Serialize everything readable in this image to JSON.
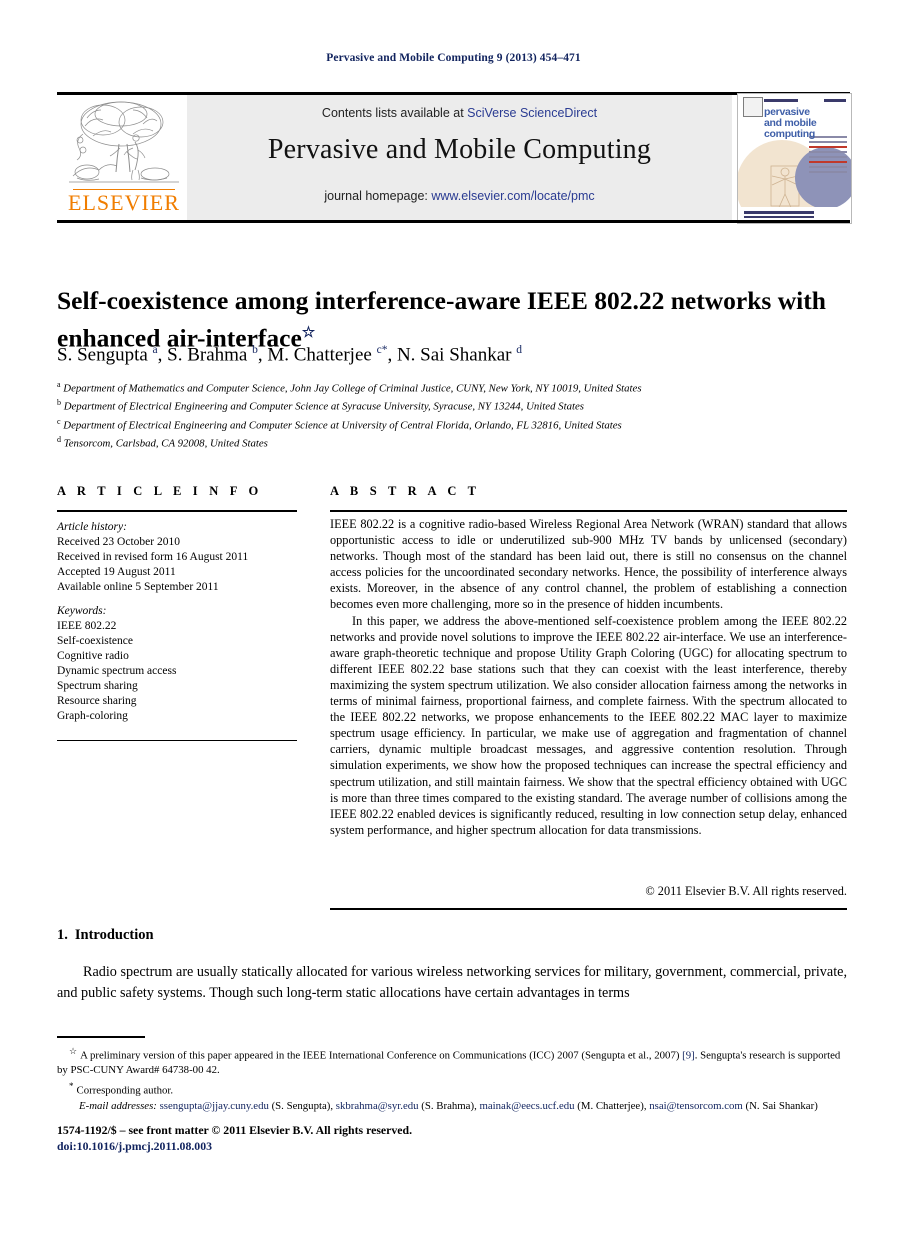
{
  "running_head": "Pervasive and Mobile Computing 9 (2013) 454–471",
  "masthead": {
    "contents_prefix": "Contents lists available at ",
    "contents_link": "SciVerse ScienceDirect",
    "journal_title": "Pervasive and Mobile Computing",
    "homepage_prefix": "journal homepage: ",
    "homepage_link": "www.elsevier.com/locate/pmc",
    "publisher_wordmark": "ELSEVIER"
  },
  "cover": {
    "line1": "pervasive",
    "line2": "and mobile",
    "line3": "computing"
  },
  "article": {
    "title": "Self-coexistence among interference-aware IEEE 802.22 networks with enhanced air-interface",
    "title_marker": "☆",
    "authors": "S. Sengupta <sup>a</sup>, S. Brahma <sup>b</sup>, M. Chatterjee <sup>c</sup><sup>*</sup>, N. Sai Shankar <sup>d</sup>",
    "affiliations": [
      {
        "marker": "a",
        "text": "Department of Mathematics and Computer Science, John Jay College of Criminal Justice, CUNY, New York, NY 10019, United States"
      },
      {
        "marker": "b",
        "text": "Department of Electrical Engineering and Computer Science at Syracuse University, Syracuse, NY 13244, United States"
      },
      {
        "marker": "c",
        "text": "Department of Electrical Engineering and Computer Science at University of Central Florida, Orlando, FL 32816, United States"
      },
      {
        "marker": "d",
        "text": "Tensorcom, Carlsbad, CA 92008, United States"
      }
    ]
  },
  "article_info": {
    "label": "A R T I C L E   I N F O",
    "history_heading": "Article history:",
    "history": [
      "Received 23 October 2010",
      "Received in revised form 16 August 2011",
      "Accepted 19 August 2011",
      "Available online 5 September 2011"
    ],
    "keywords_heading": "Keywords:",
    "keywords": [
      "IEEE 802.22",
      "Self-coexistence",
      "Cognitive radio",
      "Dynamic spectrum access",
      "Spectrum sharing",
      "Resource sharing",
      "Graph-coloring"
    ]
  },
  "abstract": {
    "label": "A B S T R A C T",
    "paragraph1": "IEEE 802.22 is a cognitive radio-based Wireless Regional Area Network (WRAN) standard that allows opportunistic access to idle or underutilized sub-900 MHz TV bands by unlicensed (secondary) networks. Though most of the standard has been laid out, there is still no consensus on the channel access policies for the uncoordinated secondary networks. Hence, the possibility of interference always exists. Moreover, in the absence of any control channel, the problem of establishing a connection becomes even more challenging, more so in the presence of hidden incumbents.",
    "paragraph2": "In this paper, we address the above-mentioned self-coexistence problem among the IEEE 802.22 networks and provide novel solutions to improve the IEEE 802.22 air-interface. We use an interference-aware graph-theoretic technique and propose Utility Graph Coloring (UGC) for allocating spectrum to different IEEE 802.22 base stations such that they can coexist with the least interference, thereby maximizing the system spectrum utilization. We also consider allocation fairness among the networks in terms of minimal fairness, proportional fairness, and complete fairness. With the spectrum allocated to the IEEE 802.22 networks, we propose enhancements to the IEEE 802.22 MAC layer to maximize spectrum usage efficiency. In particular, we make use of aggregation and fragmentation of channel carriers, dynamic multiple broadcast messages, and aggressive contention resolution. Through simulation experiments, we show how the proposed techniques can increase the spectral efficiency and spectrum utilization, and still maintain fairness. We show that the spectral efficiency obtained with UGC is more than three times compared to the existing standard. The average number of collisions among the IEEE 802.22 enabled devices is significantly reduced, resulting in low connection setup delay, enhanced system performance, and higher spectrum allocation for data transmissions.",
    "copyright": "© 2011 Elsevier B.V. All rights reserved."
  },
  "body": {
    "section_number": "1.",
    "section_title": "Introduction",
    "paragraph1": "Radio spectrum are usually statically allocated for various wireless networking services for military, government, commercial, private, and public safety systems. Though such long-term static allocations have certain advantages in terms"
  },
  "footnotes": {
    "star_marker": "☆",
    "star_text_a": "A preliminary version of this paper appeared in the IEEE International Conference on Communications (ICC) 2007 (Sengupta et al., 2007) ",
    "star_ref": "[9]",
    "star_text_b": ". Sengupta's research is supported by PSC-CUNY Award# 64738-00 42.",
    "asterisk_marker": "*",
    "corresponding": "Corresponding author.",
    "email_label": "E-mail addresses:",
    "emails": [
      {
        "address": "ssengupta@jjay.cuny.edu",
        "owner": "(S. Sengupta)"
      },
      {
        "address": "skbrahma@syr.edu",
        "owner": "(S. Brahma)"
      },
      {
        "address": "mainak@eecs.ucf.edu",
        "owner": "(M. Chatterjee)"
      },
      {
        "address": "nsai@tensorcom.com",
        "owner": "(N. Sai Shankar)"
      }
    ]
  },
  "imprint": {
    "issn_line": "1574-1192/$ – see front matter © 2011 Elsevier B.V. All rights reserved.",
    "doi_line": "doi:10.1016/j.pmcj.2011.08.003"
  },
  "colors": {
    "link_blue": "#11235e",
    "sciencedirect_blue": "#2a3b92",
    "elsevier_orange": "#f07d00",
    "masthead_gray": "#ececec"
  }
}
